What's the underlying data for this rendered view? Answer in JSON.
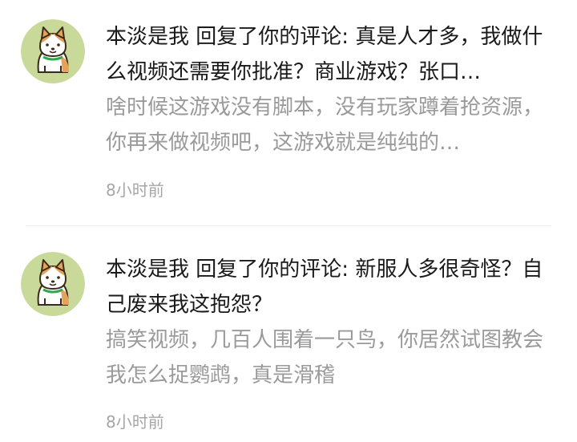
{
  "notifications": [
    {
      "avatar_icon": "shiba-dog-icon",
      "user": "本淡是我",
      "action": "回复了你的评论:",
      "reply": "真是人才多，我做什么视频还需要你批准？商业游戏？张口…",
      "quoted_comment": "啥时候这游戏没有脚本，没有玩家蹲着抢资源，你再来做视频吧，这游戏就是纯纯的…",
      "time": "8小时前"
    },
    {
      "avatar_icon": "shiba-dog-icon",
      "user": "本淡是我",
      "action": "回复了你的评论:",
      "reply": "新服人多很奇怪？自己废来我这抱怨？",
      "quoted_comment": "搞笑视频，几百人围着一只鸟，你居然试图教会我怎么捉鹦鹉，真是滑稽",
      "time": "8小时前"
    }
  ],
  "colors": {
    "primary_text": "#1a1a1a",
    "secondary_text": "#9a9a9a",
    "timestamp_text": "#a6a6a6",
    "avatar_bg": "#c8d99a",
    "divider": "#ececec"
  }
}
